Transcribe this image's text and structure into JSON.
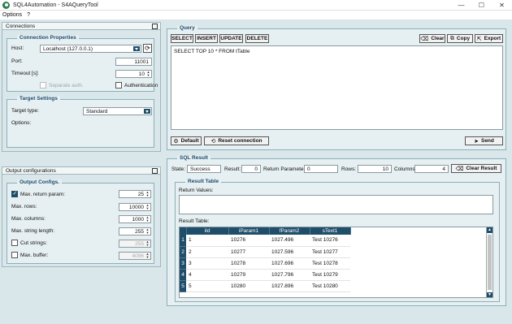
{
  "window": {
    "title": "SQL4Automation - S4AQueryTool",
    "minimize": "—",
    "maximize": "☐",
    "close": "✕"
  },
  "menu": {
    "items": [
      "Options",
      "?"
    ]
  },
  "connections": {
    "header": "Connections",
    "props_title": "Connection Properties",
    "host_label": "Host:",
    "host_value": "Localhost (127.0.0.1)",
    "port_label": "Port:",
    "port_value": "11001",
    "timeout_label": "Timeout [s]:",
    "timeout_value": "10",
    "separate_auth_label": "Separate auth.",
    "authentication_label": "Authentication",
    "target_title": "Target Settings",
    "target_type_label": "Target type:",
    "target_type_value": "Standard",
    "options_label": "Options:"
  },
  "output": {
    "header": "Output configurations",
    "group_title": "Output Configs.",
    "rows": [
      {
        "label": "Max. return param:",
        "value": "25",
        "checkbox": true,
        "checked": true,
        "dim": false
      },
      {
        "label": "Max. rows:",
        "value": "10000",
        "checkbox": false,
        "checked": false,
        "dim": false
      },
      {
        "label": "Max. columns:",
        "value": "1000",
        "checkbox": false,
        "checked": false,
        "dim": false
      },
      {
        "label": "Max. string length:",
        "value": "255",
        "checkbox": false,
        "checked": false,
        "dim": false
      },
      {
        "label": "Cut strings:",
        "value": "255",
        "checkbox": true,
        "checked": false,
        "dim": true
      },
      {
        "label": "Max. buffer:",
        "value": "4096",
        "checkbox": true,
        "checked": false,
        "dim": true
      }
    ]
  },
  "query": {
    "title": "Query",
    "select": "SELECT",
    "insert": "INSERT",
    "update": "UPDATE",
    "delete": "DELETE",
    "clear": "Clear",
    "copy": "Copy",
    "export": "Export",
    "text": "SELECT TOP 10 * FROM tTable",
    "default": "Default",
    "reset": "Reset connection",
    "send": "Send"
  },
  "result": {
    "title": "SQL Result",
    "state_label": "State:",
    "state_value": "Success",
    "result_label": "Result:",
    "result_value": "0",
    "return_params_label": "Return Parameters:",
    "return_params_value": "0",
    "rows_label": "Rows:",
    "rows_value": "10",
    "columns_label": "Columns:",
    "columns_value": "4",
    "clear_result": "Clear Result",
    "table_title": "Result Table",
    "return_values_label": "Return Values:",
    "result_table_label": "Result Table:",
    "columns": [
      "iId",
      "iParam1",
      "fParam2",
      "sText1"
    ],
    "rows": [
      {
        "n": "1",
        "cells": [
          "1",
          "10276",
          "1027.496",
          "Test 10276"
        ]
      },
      {
        "n": "2",
        "cells": [
          "2",
          "10277",
          "1027.596",
          "Test 10277"
        ]
      },
      {
        "n": "3",
        "cells": [
          "3",
          "10278",
          "1027.696",
          "Test 10278"
        ]
      },
      {
        "n": "4",
        "cells": [
          "4",
          "10279",
          "1027.796",
          "Test 10279"
        ]
      },
      {
        "n": "5",
        "cells": [
          "5",
          "10280",
          "1027.896",
          "Test 10280"
        ]
      }
    ]
  }
}
